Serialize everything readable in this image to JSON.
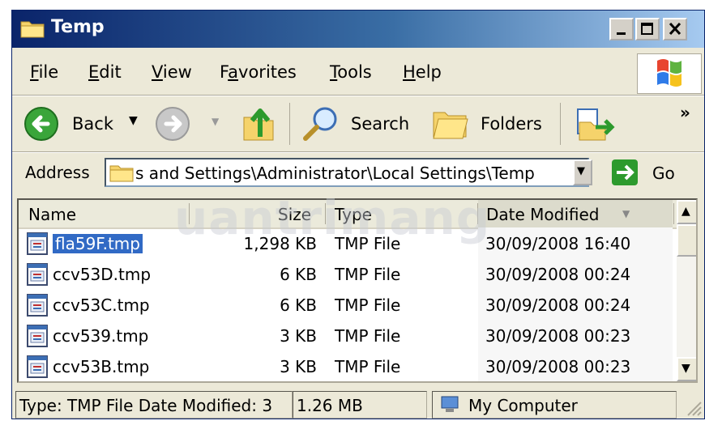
{
  "window": {
    "title": "Temp"
  },
  "menu": [
    {
      "label": "File",
      "key": "F",
      "rest": "ile"
    },
    {
      "label": "Edit",
      "key": "E",
      "rest": "dit"
    },
    {
      "label": "View",
      "key": "V",
      "rest": "iew"
    },
    {
      "label": "Favorites",
      "pre": "F",
      "key": "a",
      "rest": "vorites"
    },
    {
      "label": "Tools",
      "key": "T",
      "rest": "ools"
    },
    {
      "label": "Help",
      "key": "H",
      "rest": "elp"
    }
  ],
  "toolbar": {
    "back_label": "Back",
    "search_label": "Search",
    "folders_label": "Folders",
    "more_label": "»"
  },
  "address": {
    "label": "Address",
    "value": "s and Settings\\Administrator\\Local Settings\\Temp",
    "go_label": "Go"
  },
  "columns": {
    "name": "Name",
    "size": "Size",
    "type": "Type",
    "modified": "Date Modified"
  },
  "files": [
    {
      "name": "fla59F.tmp",
      "size": "1,298 KB",
      "type": "TMP File",
      "modified": "30/09/2008 16:40",
      "selected": true
    },
    {
      "name": "ccv53D.tmp",
      "size": "6 KB",
      "type": "TMP File",
      "modified": "30/09/2008 00:24",
      "selected": false
    },
    {
      "name": "ccv53C.tmp",
      "size": "6 KB",
      "type": "TMP File",
      "modified": "30/09/2008 00:24",
      "selected": false
    },
    {
      "name": "ccv539.tmp",
      "size": "3 KB",
      "type": "TMP File",
      "modified": "30/09/2008 00:23",
      "selected": false
    },
    {
      "name": "ccv53B.tmp",
      "size": "3 KB",
      "type": "TMP File",
      "modified": "30/09/2008 00:23",
      "selected": false
    }
  ],
  "status": {
    "info": "Type: TMP File Date Modified: 3",
    "size": "1.26 MB",
    "location": "My Computer"
  },
  "colors": {
    "selection": "#316ac5",
    "titlebar": "#0a246a",
    "go_green": "#2d9a2d"
  },
  "watermark": "uantrimang"
}
